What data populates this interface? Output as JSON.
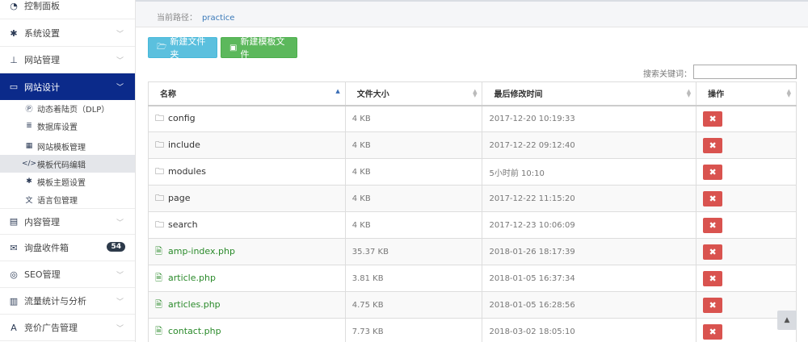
{
  "sidebar": {
    "items": [
      {
        "label": "控制面板",
        "icon": "dashboard-icon",
        "glyph": "◔",
        "chev": ""
      },
      {
        "label": "系统设置",
        "icon": "gear-icon",
        "glyph": "✱",
        "chev": "﹀"
      },
      {
        "label": "网站管理",
        "icon": "sitemap-icon",
        "glyph": "⊥",
        "chev": "﹀"
      },
      {
        "label": "网站设计",
        "icon": "monitor-icon",
        "glyph": "▭",
        "chev": "﹀"
      },
      {
        "label": "内容管理",
        "icon": "book-icon",
        "glyph": "▤",
        "chev": "﹀"
      },
      {
        "label": "询盘收件箱",
        "icon": "envelope-icon",
        "glyph": "✉",
        "badge": "54"
      },
      {
        "label": "SEO管理",
        "icon": "target-icon",
        "glyph": "◎",
        "chev": "﹀"
      },
      {
        "label": "流量统计与分析",
        "icon": "bar-chart-icon",
        "glyph": "▥",
        "chev": "﹀"
      },
      {
        "label": "竞价广告管理",
        "icon": "ad-icon",
        "glyph": "A",
        "chev": "﹀"
      }
    ],
    "subitems": [
      {
        "label": "动态着陆页（DLP）",
        "icon": "p-circle-icon",
        "glyph": "Ⓟ"
      },
      {
        "label": "数据库设置",
        "icon": "database-icon",
        "glyph": "≣"
      },
      {
        "label": "网站模板管理",
        "icon": "layout-icon",
        "glyph": "▦"
      },
      {
        "label": "模板代码编辑",
        "icon": "code-icon",
        "glyph": "</>"
      },
      {
        "label": "模板主题设置",
        "icon": "gear-small-icon",
        "glyph": "✱"
      },
      {
        "label": "语言包管理",
        "icon": "language-icon",
        "glyph": "文"
      }
    ]
  },
  "breadcrumb": {
    "label": "当前路径：",
    "path": "practice"
  },
  "toolbar": {
    "new_folder": "新建文件夹",
    "new_template_file": "新建模板文件"
  },
  "search": {
    "label": "搜索关键词：",
    "value": ""
  },
  "table": {
    "headers": [
      "名称",
      "文件大小",
      "最后修改时间",
      "操作"
    ],
    "rows": [
      {
        "name": "config",
        "type": "folder",
        "size": "4 KB",
        "modified": "2017-12-20 10:19:33"
      },
      {
        "name": "include",
        "type": "folder",
        "size": "4 KB",
        "modified": "2017-12-22 09:12:40"
      },
      {
        "name": "modules",
        "type": "folder",
        "size": "4 KB",
        "modified": "5小时前 10:10"
      },
      {
        "name": "page",
        "type": "folder",
        "size": "4 KB",
        "modified": "2017-12-22 11:15:20"
      },
      {
        "name": "search",
        "type": "folder",
        "size": "4 KB",
        "modified": "2017-12-23 10:06:09"
      },
      {
        "name": "amp-index.php",
        "type": "file",
        "size": "35.37 KB",
        "modified": "2018-01-26 18:17:39"
      },
      {
        "name": "article.php",
        "type": "file",
        "size": "3.81 KB",
        "modified": "2018-01-05 16:37:34"
      },
      {
        "name": "articles.php",
        "type": "file",
        "size": "4.75 KB",
        "modified": "2018-01-05 16:28:56"
      },
      {
        "name": "contact.php",
        "type": "file",
        "size": "7.73 KB",
        "modified": "2018-03-02 18:05:10"
      }
    ],
    "delete_glyph": "✖"
  },
  "colors": {
    "sidebar_active": "#0b2a8a",
    "info": "#5bc0de",
    "success": "#5cb85c",
    "danger": "#d9534f",
    "link": "#3a79b8"
  }
}
